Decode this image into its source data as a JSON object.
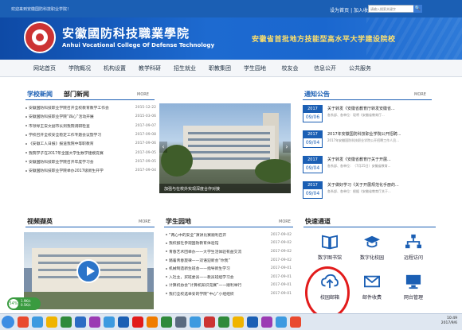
{
  "topbar": {
    "welcome": "欢迎来到安徽国防科技职业学院！",
    "links": "设为首页 | 加入收藏",
    "search_placeholder": "请输入搜索关键字",
    "search_button": "🔍"
  },
  "banner": {
    "cn_name": "安徽國防科技職業學院",
    "en_name": "Anhui Vocational College Of Defense Technology",
    "slogan": "安徽省首批地方技能型高水平大学建设院校"
  },
  "nav": [
    "网站首页",
    "学院概况",
    "机构设置",
    "教学科研",
    "招生就业",
    "职教集团",
    "学生园地",
    "校友会",
    "信息公开",
    "公共服务"
  ],
  "news": {
    "tab1": "学校新闻",
    "tab2": "部门新闻",
    "more": "MORE",
    "items": [
      {
        "title": "安徽国防科技职业学院召开全校教育教学工作会",
        "date": "2015-12-22"
      },
      {
        "title": "安徽国防科技职业学院“四心”活动开展",
        "date": "2015-03-06"
      },
      {
        "title": "市领导王安文副市长到我院调研检查",
        "date": "2017-09-07"
      },
      {
        "title": "学校召开全校安全稳定工作专题会议暨学习",
        "date": "2017-09-08"
      },
      {
        "title": "《安徽工人日报》报道我院中等职教育",
        "date": "2017-09-06"
      },
      {
        "title": "我院学子在2017年全国大学生数学建模竞赛",
        "date": "2017-09-05"
      },
      {
        "title": "安徽国防科技职业学院召开年度学习会",
        "date": "2017-09-05"
      },
      {
        "title": "安徽国防科技职业学院举办2017级新生开学",
        "date": "2017-09-04"
      }
    ]
  },
  "photo": {
    "caption": "加强与在校外实现深度合作对接"
  },
  "notice": {
    "title": "通知公告",
    "more": "MORE",
    "items": [
      {
        "year": "2017",
        "md": "09/06",
        "title": "关于转发《安徽省教育厅转发安徽省...",
        "meta": "各系部、各单位：现将《安徽省教育厅..."
      },
      {
        "year": "2017",
        "md": "09/04",
        "title": "2017年安徽国防科技职业学院公开招聘...",
        "meta": "2017年安徽国防科技职业学院公开招聘工作人员..."
      },
      {
        "year": "2017",
        "md": "09/04",
        "title": "关于转发《安徽省教育厅关于开展...",
        "meta": "各系部、各单位：（7月25日）安徽省教育..."
      },
      {
        "year": "2017",
        "md": "09/04",
        "title": "关于做好学习《关于开展规范化手册的...",
        "meta": "各系部、各单位：根据《安徽省教育厅关于..."
      }
    ]
  },
  "video": {
    "title": "视频撷英",
    "more": "MORE"
  },
  "campus": {
    "title": "学生园地",
    "more": "MORE",
    "items": [
      {
        "title": "“两心中的安全”演讲比赛顺利召开",
        "date": "2017-09-02"
      },
      {
        "title": "我校报社参观国防教育体验馆",
        "date": "2017-09-02"
      },
      {
        "title": "青春艺术团举办——大学生活体验有益交流",
        "date": "2017-09-02"
      },
      {
        "title": "踏着青春旋律——双语迎新会“你我”",
        "date": "2017-09-02"
      },
      {
        "title": "机械制造新生班会——指导新生学习",
        "date": "2017-09-01"
      },
      {
        "title": "入社主，买班委员——教员班组学习会",
        "date": "2017-09-01"
      },
      {
        "title": "计算机协会“计算机知识竞赛”——顺利举行",
        "date": "2017-09-01"
      },
      {
        "title": "我们全校选举安的学院“中心”小组组织",
        "date": "2017-09-01"
      }
    ]
  },
  "quick": {
    "title": "快速通道",
    "items": [
      {
        "label": "数字图书馆",
        "icon": "book-icon"
      },
      {
        "label": "数字化校园",
        "icon": "graduation-cap-icon"
      },
      {
        "label": "远程访问",
        "icon": "network-icon"
      },
      {
        "label": "校园邮箱",
        "icon": "upload-cloud-icon"
      },
      {
        "label": "邮件收费",
        "icon": "mail-icon"
      },
      {
        "label": "网台管理",
        "icon": "monitor-icon"
      }
    ]
  },
  "taskbar": {
    "clock_time": "10:49",
    "clock_date": "2017/9/6"
  },
  "float_widget": {
    "pct": "54%",
    "up": "1.9K/s",
    "down": "0.5K/s"
  }
}
